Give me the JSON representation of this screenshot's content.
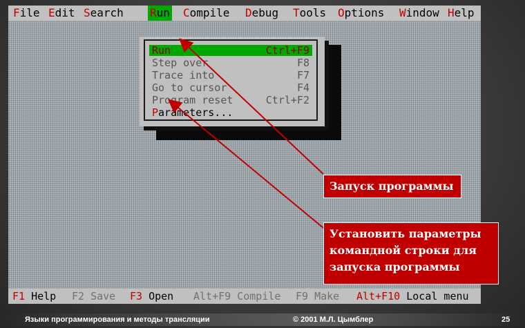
{
  "menubar": {
    "items": [
      {
        "hot": "F",
        "rest": "ile"
      },
      {
        "hot": "E",
        "rest": "dit"
      },
      {
        "hot": "S",
        "rest": "earch"
      },
      {
        "hot": "R",
        "rest": "un"
      },
      {
        "hot": "C",
        "rest": "ompile"
      },
      {
        "hot": "D",
        "rest": "ebug"
      },
      {
        "hot": "T",
        "rest": "ools"
      },
      {
        "hot": "O",
        "rest": "ptions"
      },
      {
        "hot": "W",
        "rest": "indow"
      },
      {
        "hot": "H",
        "rest": "elp"
      }
    ],
    "active": "Run"
  },
  "run_menu": {
    "items": [
      {
        "label": "Run",
        "shortcut": "Ctrl+F9",
        "state": "selected"
      },
      {
        "label": "Step over",
        "shortcut": "F8",
        "state": "disabled"
      },
      {
        "label": "Trace into",
        "shortcut": "F7",
        "state": "disabled"
      },
      {
        "label": "Go to cursor",
        "shortcut": "F4",
        "state": "disabled"
      },
      {
        "label": "Program reset",
        "shortcut": "Ctrl+F2",
        "state": "disabled"
      },
      {
        "label_hot": "P",
        "label_rest": "arameters...",
        "shortcut": "",
        "state": "enabled"
      }
    ]
  },
  "statusbar": {
    "items": [
      {
        "key": "F1",
        "label": " Help",
        "enabled": true
      },
      {
        "key": "F2",
        "label": " Save",
        "enabled": false
      },
      {
        "key": "F3",
        "label": " Open",
        "enabled": true
      },
      {
        "key": "Alt+F9",
        "label": " Compile",
        "enabled": false
      },
      {
        "key": "F9",
        "label": " Make",
        "enabled": false
      },
      {
        "key": "Alt+F10",
        "label": " Local menu",
        "enabled": true
      }
    ]
  },
  "callouts": {
    "run": "Запуск программы",
    "params_line1": "Установить параметры",
    "params_line2": "командной строки для",
    "params_line3": "запуска программы"
  },
  "footer": {
    "course": "Языки программирования и методы трансляции",
    "copyright": "© 2001 М.Л. Цымблер",
    "page": "25"
  },
  "colors": {
    "screen_bg": "#c0c0c0",
    "menu_highlight": "#00a800",
    "hotkey": "#c00000",
    "callout_bg": "#c00000",
    "desktop": "#aab2b8"
  }
}
